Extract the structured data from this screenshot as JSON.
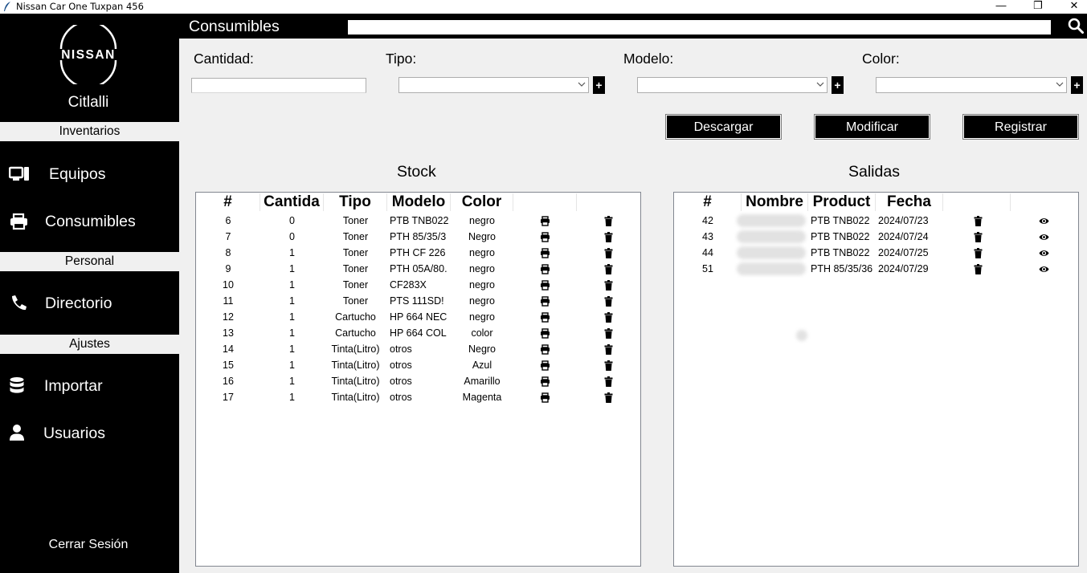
{
  "window": {
    "title": "Nissan Car One Tuxpan 456",
    "minimize": "—",
    "maximize": "❐",
    "close": "✕"
  },
  "sidebar": {
    "brand": "NISSAN",
    "user": "Citlalli",
    "sections": {
      "inventarios": "Inventarios",
      "personal": "Personal",
      "ajustes": "Ajustes"
    },
    "items": {
      "equipos": {
        "label": "Equipos",
        "icon": "computer-icon"
      },
      "consumibles": {
        "label": "Consumibles",
        "icon": "printer-icon"
      },
      "directorio": {
        "label": "Directorio",
        "icon": "phone-icon"
      },
      "importar": {
        "label": "Importar",
        "icon": "database-icon"
      },
      "usuarios": {
        "label": "Usuarios",
        "icon": "user-icon"
      }
    },
    "logout": "Cerrar Sesión"
  },
  "header": {
    "title": "Consumibles",
    "search_value": "",
    "search_icon": "search-icon"
  },
  "form": {
    "cantidad_label": "Cantidad:",
    "tipo_label": "Tipo:",
    "modelo_label": "Modelo:",
    "color_label": "Color:",
    "cantidad_value": "",
    "add_label": "+"
  },
  "actions": {
    "descargar": "Descargar",
    "modificar": "Modificar",
    "registrar": "Registrar"
  },
  "stock": {
    "title": "Stock",
    "columns": [
      "#",
      "Cantida",
      "Tipo",
      "Modelo",
      "Color"
    ],
    "rows": [
      [
        "6",
        "0",
        "Toner",
        "PTB TNB022",
        "negro"
      ],
      [
        "7",
        "0",
        "Toner",
        "PTH 85/35/3",
        "Negro"
      ],
      [
        "8",
        "1",
        "Toner",
        "PTH CF 226",
        "negro"
      ],
      [
        "9",
        "1",
        "Toner",
        "PTH 05A/80.",
        "negro"
      ],
      [
        "10",
        "1",
        "Toner",
        "CF283X",
        "negro"
      ],
      [
        "11",
        "1",
        "Toner",
        "PTS 111SD!",
        "negro"
      ],
      [
        "12",
        "1",
        "Cartucho",
        "HP 664 NEC",
        "negro"
      ],
      [
        "13",
        "1",
        "Cartucho",
        "HP 664 COL",
        "color"
      ],
      [
        "14",
        "1",
        "Tinta(Litro)",
        "otros",
        "Negro"
      ],
      [
        "15",
        "1",
        "Tinta(Litro)",
        "otros",
        "Azul"
      ],
      [
        "16",
        "1",
        "Tinta(Litro)",
        "otros",
        "Amarillo"
      ],
      [
        "17",
        "1",
        "Tinta(Litro)",
        "otros",
        "Magenta"
      ]
    ]
  },
  "salidas": {
    "title": "Salidas",
    "columns": [
      "#",
      "Nombre",
      "Product",
      "Fecha"
    ],
    "rows": [
      [
        "42",
        "",
        "PTB TNB022",
        "2024/07/23"
      ],
      [
        "43",
        "",
        "PTB TNB022",
        "2024/07/24"
      ],
      [
        "44",
        "",
        "PTB TNB022",
        "2024/07/25"
      ],
      [
        "51",
        "",
        "PTH 85/35/36",
        "2024/07/29"
      ]
    ]
  }
}
